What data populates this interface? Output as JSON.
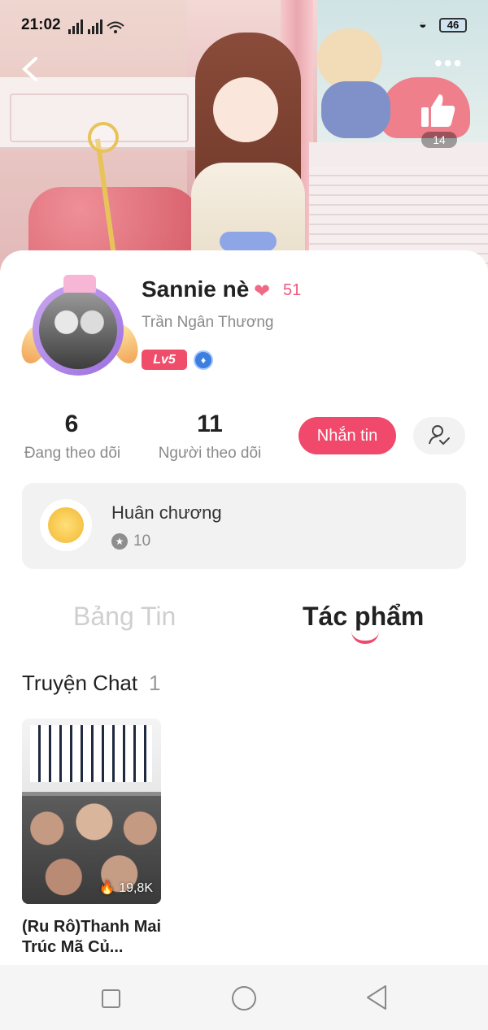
{
  "status_bar": {
    "time": "21:02",
    "battery": "46"
  },
  "header": {
    "likes": "14"
  },
  "profile": {
    "display_name": "Sannie nè",
    "hearts": "51",
    "real_name": "Trần Ngân Thương",
    "level": "Lv5"
  },
  "stats": {
    "following": {
      "value": "6",
      "label": "Đang theo dõi"
    },
    "followers": {
      "value": "11",
      "label": "Người theo dõi"
    }
  },
  "actions": {
    "message_label": "Nhắn tin"
  },
  "medal": {
    "title": "Huân chương",
    "count": "10"
  },
  "tabs": [
    {
      "label": "Bảng Tin",
      "active": false
    },
    {
      "label": "Tác phẩm",
      "active": true
    }
  ],
  "section": {
    "title": "Truyện Chat",
    "count": "1"
  },
  "stories": [
    {
      "title": "(Ru Rô)Thanh Mai Trúc Mã Củ...",
      "views": "19,8K"
    }
  ],
  "colors": {
    "accent": "#f0496b",
    "muted_text": "#8a8a8a",
    "card_bg": "#f2f2f2"
  }
}
